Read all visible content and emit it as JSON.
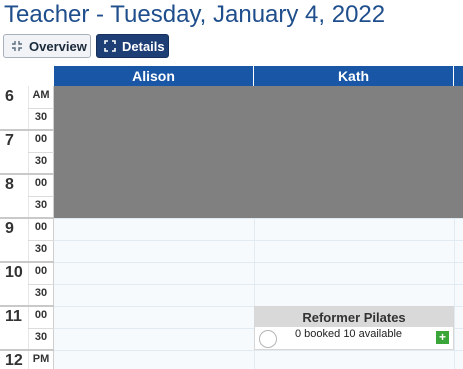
{
  "header": {
    "title": "Teacher - Tuesday, January 4, 2022"
  },
  "toolbar": {
    "overview_label": "Overview",
    "details_label": "Details",
    "active_view": "Details"
  },
  "calendar": {
    "columns": [
      "Alison",
      "Kath"
    ],
    "hours": [
      {
        "hour": "6",
        "top": "AM",
        "bottom": "30"
      },
      {
        "hour": "7",
        "top": "00",
        "bottom": "30"
      },
      {
        "hour": "8",
        "top": "00",
        "bottom": "30"
      },
      {
        "hour": "9",
        "top": "00",
        "bottom": "30"
      },
      {
        "hour": "10",
        "top": "00",
        "bottom": "30"
      },
      {
        "hour": "11",
        "top": "00",
        "bottom": "30"
      },
      {
        "hour": "12",
        "top": "PM",
        "bottom": ""
      }
    ],
    "event": {
      "title": "Reformer Pilates",
      "status": "0 booked 10 available",
      "add_symbol": "+"
    }
  },
  "colors": {
    "title": "#1f4e8c",
    "header_bg": "#1956a6",
    "unavailable": "#808080",
    "grid_bg": "#f6fafd",
    "add_button": "#3aa63a"
  }
}
